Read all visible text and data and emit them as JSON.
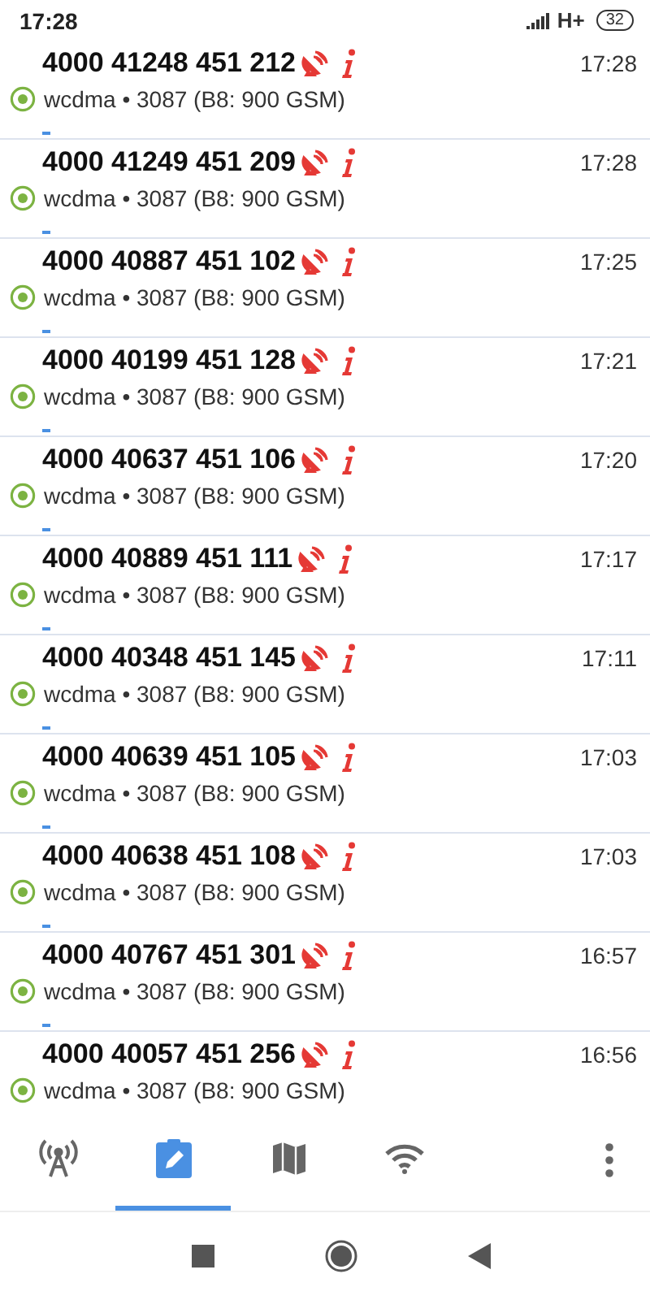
{
  "status_bar": {
    "time": "17:28",
    "network": "H+",
    "battery": "32"
  },
  "cells": [
    {
      "id": "4000 41248 451 212",
      "time": "17:28",
      "info": "wcdma • 3087 (B8: 900 GSM)"
    },
    {
      "id": "4000 41249 451 209",
      "time": "17:28",
      "info": "wcdma • 3087 (B8: 900 GSM)"
    },
    {
      "id": "4000 40887 451 102",
      "time": "17:25",
      "info": "wcdma • 3087 (B8: 900 GSM)"
    },
    {
      "id": "4000 40199 451 128",
      "time": "17:21",
      "info": "wcdma • 3087 (B8: 900 GSM)"
    },
    {
      "id": "4000 40637 451 106",
      "time": "17:20",
      "info": "wcdma • 3087 (B8: 900 GSM)"
    },
    {
      "id": "4000 40889 451 111",
      "time": "17:17",
      "info": "wcdma • 3087 (B8: 900 GSM)"
    },
    {
      "id": "4000 40348 451 145",
      "time": "17:11",
      "info": "wcdma • 3087 (B8: 900 GSM)"
    },
    {
      "id": "4000 40639 451 105",
      "time": "17:03",
      "info": "wcdma • 3087 (B8: 900 GSM)"
    },
    {
      "id": "4000 40638 451 108",
      "time": "17:03",
      "info": "wcdma • 3087 (B8: 900 GSM)"
    },
    {
      "id": "4000 40767 451 301",
      "time": "16:57",
      "info": "wcdma • 3087 (B8: 900 GSM)"
    },
    {
      "id": "4000 40057 451 256",
      "time": "16:56",
      "info": "wcdma • 3087 (B8: 900 GSM)"
    }
  ],
  "tabs": [
    {
      "kind": "tower",
      "selected": false
    },
    {
      "kind": "log",
      "selected": true
    },
    {
      "kind": "map",
      "selected": false
    },
    {
      "kind": "wifi",
      "selected": false
    }
  ]
}
